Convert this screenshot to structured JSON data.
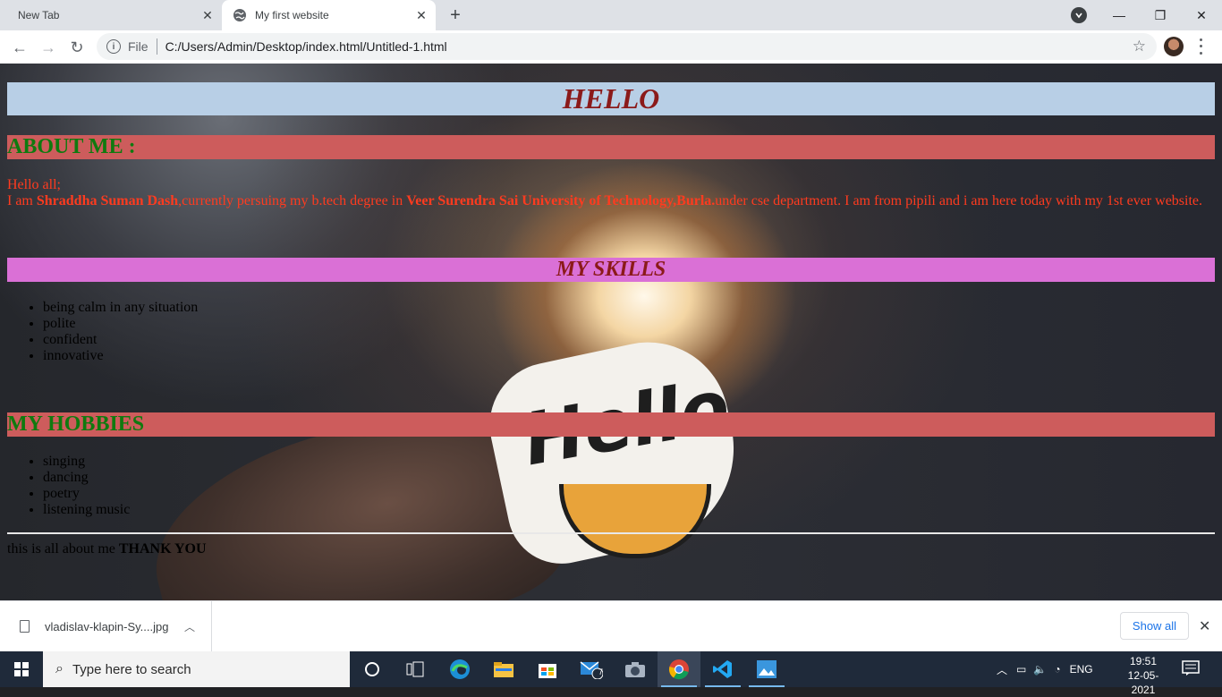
{
  "browser": {
    "tabs": [
      {
        "title": "New Tab",
        "active": false
      },
      {
        "title": "My first website",
        "active": true
      }
    ],
    "address": {
      "scheme_label": "File",
      "url": "C:/Users/Admin/Desktop/index.html/Untitled-1.html"
    }
  },
  "page": {
    "heading": "HELLO",
    "about_heading": "ABOUT ME :",
    "intro_line1": "Hello all;",
    "intro_line2_start": "I am ",
    "intro_name": "Shraddha Suman Dash",
    "intro_line2_mid": ",currently persuing my b.tech degree in ",
    "intro_university": "Veer Surendra Sai University of Technology,Burla.",
    "intro_line2_end": "under cse department. I am from pipili and i am here today with my 1st ever website.",
    "skills_heading": "MY SKILLS",
    "skills": [
      "being calm in any situation",
      "polite",
      "confident",
      "innovative"
    ],
    "hobbies_heading": "MY HOBBIES",
    "hobbies": [
      "singing",
      "dancing",
      "poetry",
      "listening music"
    ],
    "outro_text": "this is all about me ",
    "outro_bold": "THANK YOU",
    "colors": {
      "heading_bg": "#b8cfe6",
      "heading_text": "#8b1a1a",
      "section_bg": "#cd5c5c",
      "section_text": "#0f7a0f",
      "skills_bg": "#da70d6",
      "intro_text": "#ff3b1f"
    }
  },
  "downloads": {
    "file_name": "vladislav-klapin-Sy....jpg",
    "show_all": "Show all"
  },
  "taskbar": {
    "search_placeholder": "Type here to search",
    "mail_badge": "7",
    "language": "ENG",
    "time": "19:51",
    "date": "12-05-2021"
  }
}
